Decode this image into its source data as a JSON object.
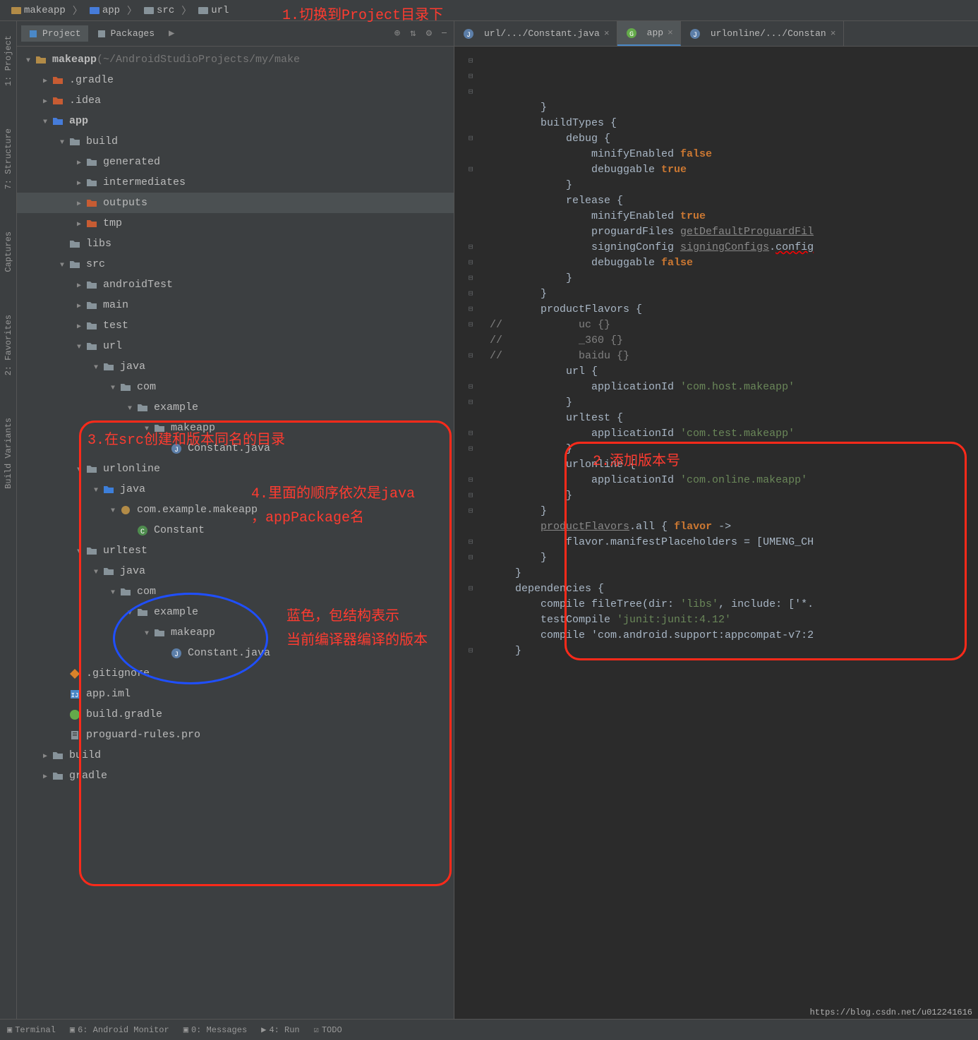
{
  "breadcrumb": [
    "makeapp",
    "app",
    "src",
    "url"
  ],
  "annotations": {
    "a1": "1.切换到Project目录下",
    "a2": "2.添加版本号",
    "a3": "3.在src创建和版本同名的目录",
    "a4a": "4.里面的顺序依次是java",
    "a4b": "，appPackage名",
    "a5a": "蓝色，包结构表示",
    "a5b": "当前编译器编译的版本"
  },
  "project_tabs": {
    "project": "Project",
    "packages": "Packages"
  },
  "rail": {
    "project": "1: Project",
    "structure": "7: Structure",
    "captures": "Captures",
    "favorites": "2: Favorites",
    "build_variants": "Build Variants"
  },
  "tree": [
    {
      "d": 0,
      "a": "open",
      "i": "proj",
      "t": "makeapp",
      "suffix": " (~/AndroidStudioProjects/my/make",
      "bold": true
    },
    {
      "d": 1,
      "a": "closed",
      "i": "folder-orange",
      "t": ".gradle"
    },
    {
      "d": 1,
      "a": "closed",
      "i": "folder-orange",
      "t": ".idea"
    },
    {
      "d": 1,
      "a": "open",
      "i": "module",
      "t": "app",
      "bold": true
    },
    {
      "d": 2,
      "a": "open",
      "i": "folder",
      "t": "build"
    },
    {
      "d": 3,
      "a": "closed",
      "i": "folder",
      "t": "generated"
    },
    {
      "d": 3,
      "a": "closed",
      "i": "folder",
      "t": "intermediates"
    },
    {
      "d": 3,
      "a": "closed",
      "i": "folder-orange",
      "t": "outputs",
      "sel": true
    },
    {
      "d": 3,
      "a": "closed",
      "i": "folder-orange",
      "t": "tmp"
    },
    {
      "d": 2,
      "a": "none",
      "i": "folder",
      "t": "libs"
    },
    {
      "d": 2,
      "a": "open",
      "i": "folder",
      "t": "src"
    },
    {
      "d": 3,
      "a": "closed",
      "i": "folder",
      "t": "androidTest"
    },
    {
      "d": 3,
      "a": "closed",
      "i": "folder",
      "t": "main"
    },
    {
      "d": 3,
      "a": "closed",
      "i": "folder",
      "t": "test"
    },
    {
      "d": 3,
      "a": "open",
      "i": "folder",
      "t": "url"
    },
    {
      "d": 4,
      "a": "open",
      "i": "folder",
      "t": "java"
    },
    {
      "d": 5,
      "a": "open",
      "i": "folder",
      "t": "com"
    },
    {
      "d": 6,
      "a": "open",
      "i": "folder",
      "t": "example"
    },
    {
      "d": 7,
      "a": "open",
      "i": "folder",
      "t": "makeapp"
    },
    {
      "d": 8,
      "a": "none",
      "i": "java",
      "t": "Constant.java"
    },
    {
      "d": 3,
      "a": "open",
      "i": "folder",
      "t": "urlonline"
    },
    {
      "d": 4,
      "a": "open",
      "i": "folder-blue",
      "t": "java"
    },
    {
      "d": 5,
      "a": "open",
      "i": "package",
      "t": "com.example.makeapp"
    },
    {
      "d": 6,
      "a": "none",
      "i": "class",
      "t": "Constant"
    },
    {
      "d": 3,
      "a": "open",
      "i": "folder",
      "t": "urltest"
    },
    {
      "d": 4,
      "a": "open",
      "i": "folder",
      "t": "java"
    },
    {
      "d": 5,
      "a": "open",
      "i": "folder",
      "t": "com"
    },
    {
      "d": 6,
      "a": "open",
      "i": "folder",
      "t": "example"
    },
    {
      "d": 7,
      "a": "open",
      "i": "folder",
      "t": "makeapp"
    },
    {
      "d": 8,
      "a": "none",
      "i": "java",
      "t": "Constant.java"
    },
    {
      "d": 2,
      "a": "none",
      "i": "git",
      "t": ".gitignore"
    },
    {
      "d": 2,
      "a": "none",
      "i": "iml",
      "t": "app.iml"
    },
    {
      "d": 2,
      "a": "none",
      "i": "gradle",
      "t": "build.gradle"
    },
    {
      "d": 2,
      "a": "none",
      "i": "text",
      "t": "proguard-rules.pro"
    },
    {
      "d": 1,
      "a": "closed",
      "i": "folder",
      "t": "build"
    },
    {
      "d": 1,
      "a": "closed",
      "i": "folder",
      "t": "gradle"
    }
  ],
  "editor_tabs": [
    {
      "icon": "java",
      "label": "url/.../Constant.java",
      "active": false
    },
    {
      "icon": "gradle-g",
      "label": "app",
      "active": true
    },
    {
      "icon": "java",
      "label": "urlonline/.../Constan",
      "active": false
    }
  ],
  "code": {
    "lines": [
      "        }",
      "        buildTypes {",
      "            debug {",
      "                minifyEnabled false",
      "                debuggable true",
      "            }",
      "",
      "            release {",
      "                minifyEnabled true",
      "                proguardFiles getDefaultProguardFil",
      "                signingConfig signingConfigs.config",
      "                debuggable false",
      "            }",
      "        }",
      "        productFlavors {",
      "//            uc {}",
      "//            _360 {}",
      "//            baidu {}",
      "",
      "            url {",
      "                applicationId 'com.host.makeapp'",
      "            }",
      "            urltest {",
      "                applicationId 'com.test.makeapp'",
      "            }",
      "            urlonline {",
      "                applicationId 'com.online.makeapp'",
      "            }",
      "        }",
      "        productFlavors.all { flavor ->",
      "            flavor.manifestPlaceholders = [UMENG_CH",
      "        }",
      "    }",
      "",
      "    dependencies {",
      "        compile fileTree(dir: 'libs', include: ['*.",
      "        testCompile 'junit:junit:4.12'",
      "        compile 'com.android.support:appcompat-v7:2",
      "    }"
    ]
  },
  "bottom": {
    "terminal": "Terminal",
    "monitor": "6: Android Monitor",
    "messages": "0: Messages",
    "run": "4: Run",
    "todo": "TODO"
  },
  "watermark": "https://blog.csdn.net/u012241616"
}
